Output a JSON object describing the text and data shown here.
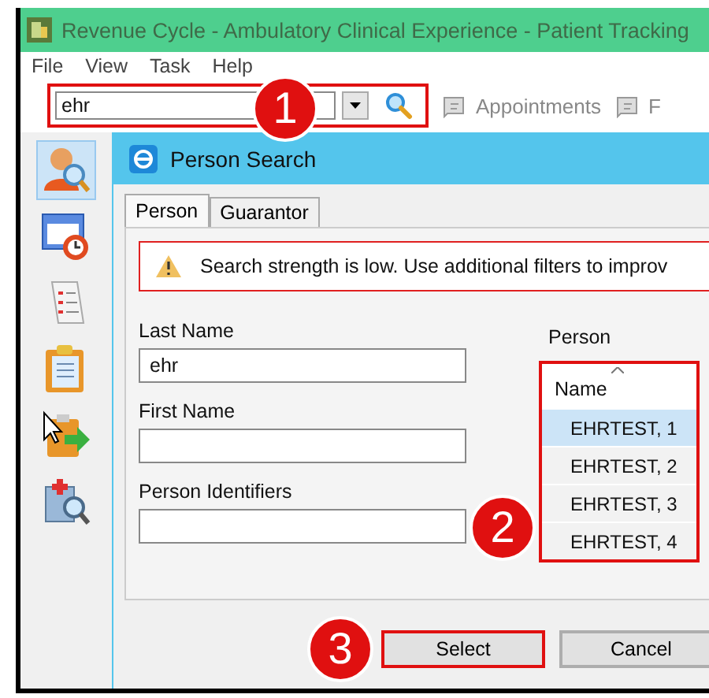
{
  "window": {
    "title": "Revenue Cycle - Ambulatory Clinical Experience - Patient Tracking"
  },
  "menu": [
    "File",
    "View",
    "Task",
    "Help"
  ],
  "toolbar": {
    "search": {
      "value": "ehr",
      "highlighted": true
    },
    "buttons": [
      {
        "label": "Appointments",
        "disabled": true
      },
      {
        "label": "F",
        "disabled": true
      }
    ]
  },
  "sidebar": {
    "items": [
      {
        "selected": true
      },
      {
        "selected": false
      },
      {
        "selected": false
      },
      {
        "selected": false
      },
      {
        "selected": false
      },
      {
        "selected": false
      }
    ]
  },
  "dialog": {
    "title": "Person Search",
    "tabs": [
      {
        "label": "Person",
        "selected": true
      },
      {
        "label": "Guarantor",
        "selected": false
      }
    ],
    "warning": "Search strength is low. Use additional filters to improv",
    "fields": [
      {
        "label": "Last Name",
        "value": "ehr"
      },
      {
        "label": "First Name"
      },
      {
        "label": "Person Identifiers"
      }
    ],
    "results": {
      "title": "Person",
      "highlighted": true,
      "columns": [
        "Name"
      ],
      "rows": [
        {
          "name": "EHRTEST, 1",
          "selected": true
        },
        {
          "name": "EHRTEST, 2",
          "selected": false
        },
        {
          "name": "EHRTEST, 3",
          "selected": false
        },
        {
          "name": "EHRTEST, 4",
          "selected": false
        }
      ]
    },
    "buttons": [
      {
        "label": "Select",
        "highlighted": true
      },
      {
        "label": "Cancel",
        "highlighted": false
      }
    ]
  },
  "callouts": [
    "1",
    "2",
    "3"
  ]
}
